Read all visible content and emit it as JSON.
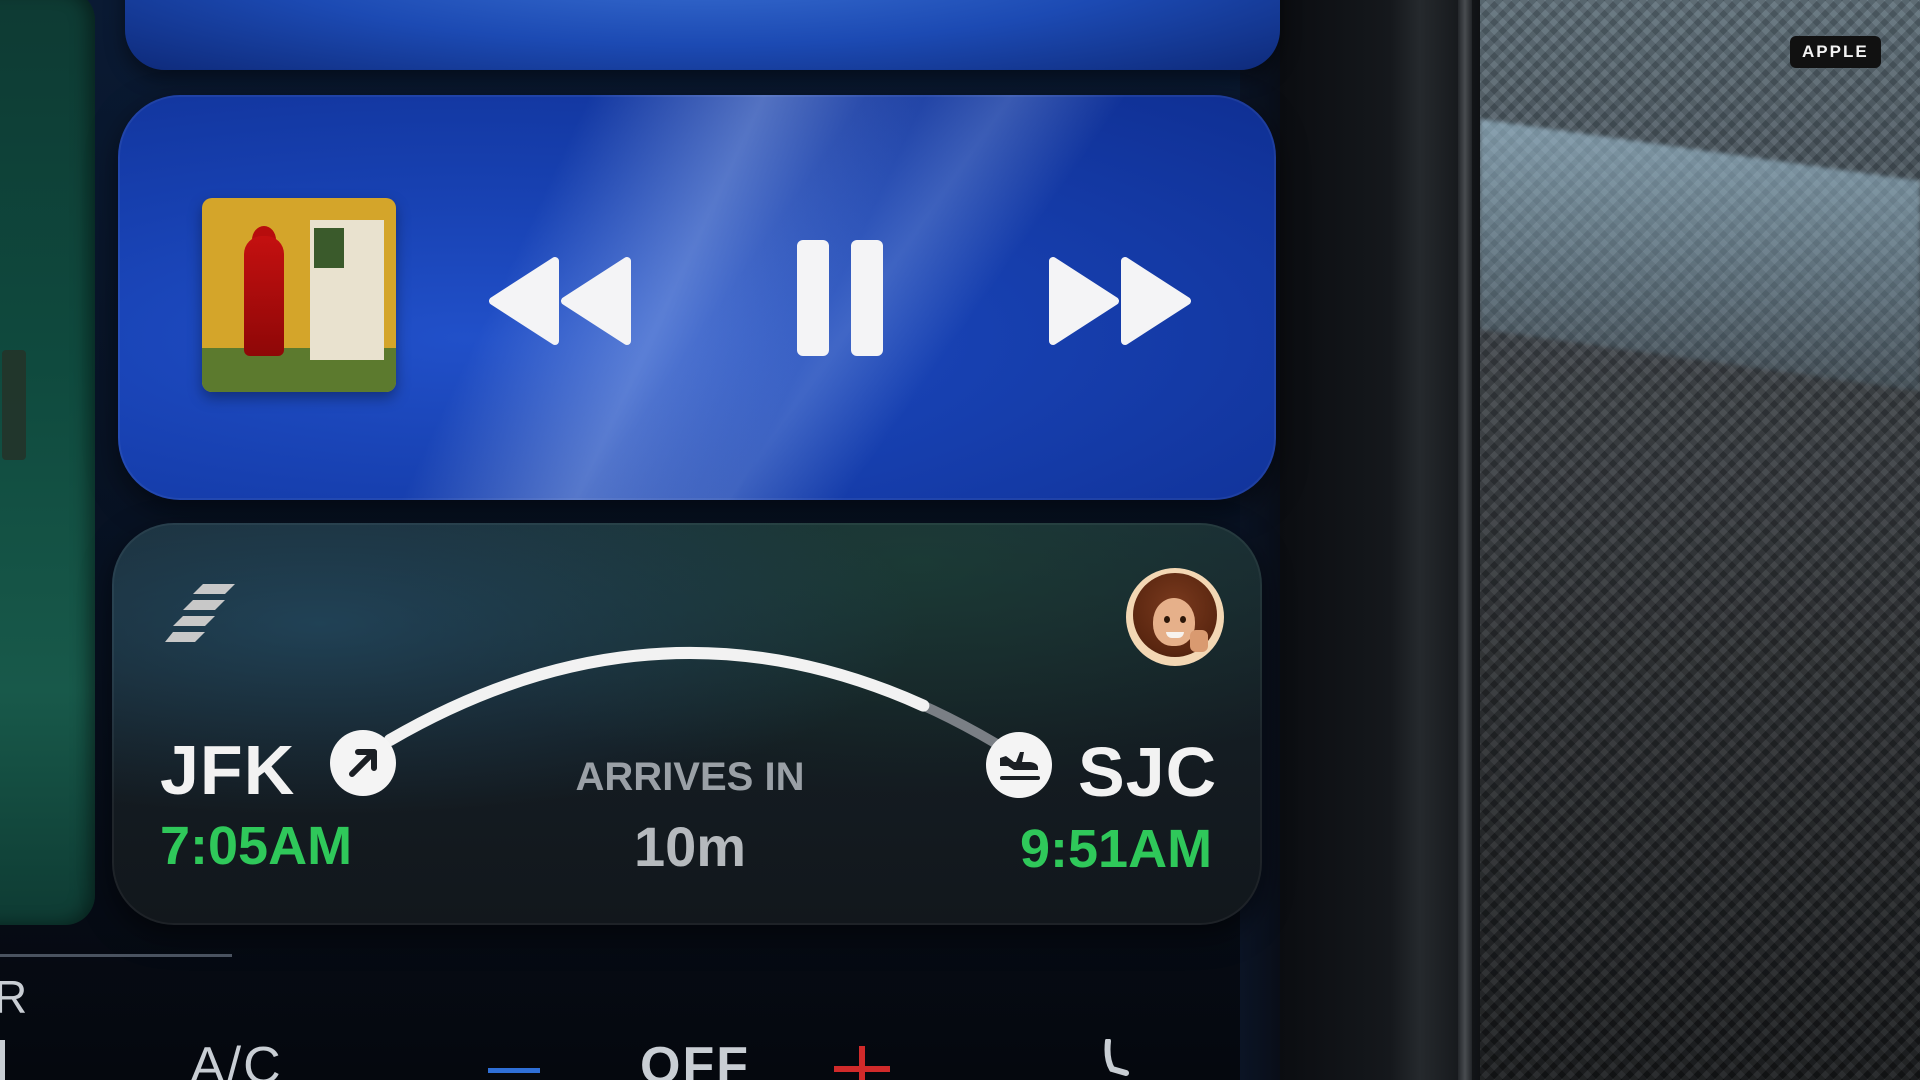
{
  "watermark": "APPLE",
  "media": {
    "album_art": "album-artwork",
    "controls": {
      "rewind": "rewind-icon",
      "pause": "pause-icon",
      "forward": "fast-forward-icon"
    }
  },
  "flight": {
    "origin": {
      "code": "JFK",
      "time": "7:05AM"
    },
    "destination": {
      "code": "SJC",
      "time": "9:51AM"
    },
    "arrives_label": "ARRIVES IN",
    "arrives_value": "10m",
    "progress": 0.85,
    "airline_logo": "airline-stripes-icon",
    "colors": {
      "time": "#2fc85a",
      "progress": "#f2f2f2",
      "remaining": "#7a7f85"
    }
  },
  "climate": {
    "left_label": "R",
    "ac_label": "A/C",
    "fan_label": "OFF",
    "minus_color": "#2f6fd6",
    "plus_color": "#d12a2a",
    "seat": "seat-icon"
  }
}
